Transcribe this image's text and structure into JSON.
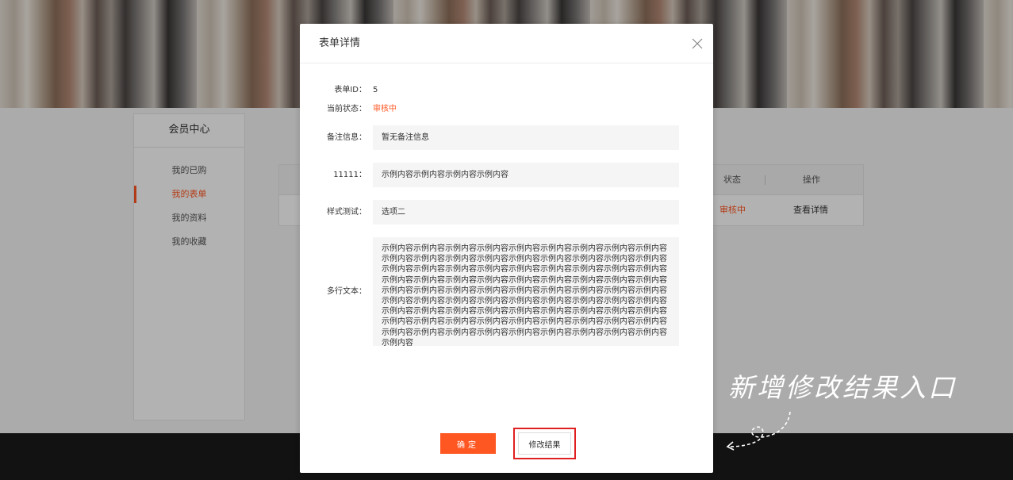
{
  "background": {
    "sidebar": {
      "title": "会员中心",
      "items": [
        {
          "label": "我的已购",
          "active": false
        },
        {
          "label": "我的表单",
          "active": true
        },
        {
          "label": "我的资料",
          "active": false
        },
        {
          "label": "我的收藏",
          "active": false
        }
      ]
    },
    "table": {
      "headers": {
        "status": "状态",
        "ops": "操作"
      },
      "row": {
        "status": "审核中",
        "ops": "查看详情"
      }
    }
  },
  "modal": {
    "title": "表单详情",
    "fields": {
      "form_id_label": "表单ID：",
      "form_id_value": "5",
      "status_label": "当前状态：",
      "status_value": "审核中",
      "remark_label": "备注信息：",
      "remark_value": "暂无备注信息",
      "field_11111_label": "11111：",
      "field_11111_value": "示例内容示例内容示例内容示例内容",
      "style_test_label": "样式测试：",
      "style_test_value": "选项二",
      "multiline_label": "多行文本：",
      "multiline_value": "示例内容示例内容示例内容示例内容示例内容示例内容示例内容示例内容示例内容示例内容示例内容示例内容示例内容示例内容示例内容示例内容示例内容示例内容示例内容示例内容示例内容示例内容示例内容示例内容示例内容示例内容示例内容示例内容示例内容示例内容示例内容示例内容示例内容示例内容示例内容示例内容示例内容示例内容示例内容示例内容示例内容示例内容示例内容示例内容示例内容示例内容示例内容示例内容示例内容示例内容示例内容示例内容示例内容示例内容示例内容示例内容示例内容示例内容示例内容示例内容示例内容示例内容示例内容示例内容示例内容示例内容示例内容示例内容示例内容示例内容示例内容示例内容示例内容示例内容示例内容示例内容示例内容示例内容示例内容示例内容示例内容示例内容"
    },
    "footer": {
      "confirm_label": "确定",
      "modify_label": "修改结果"
    }
  },
  "annotation": {
    "text": "新增修改结果入口"
  },
  "colors": {
    "accent": "#ff5722",
    "highlight_border": "#e02020"
  },
  "icons": {
    "close": "close-icon"
  }
}
